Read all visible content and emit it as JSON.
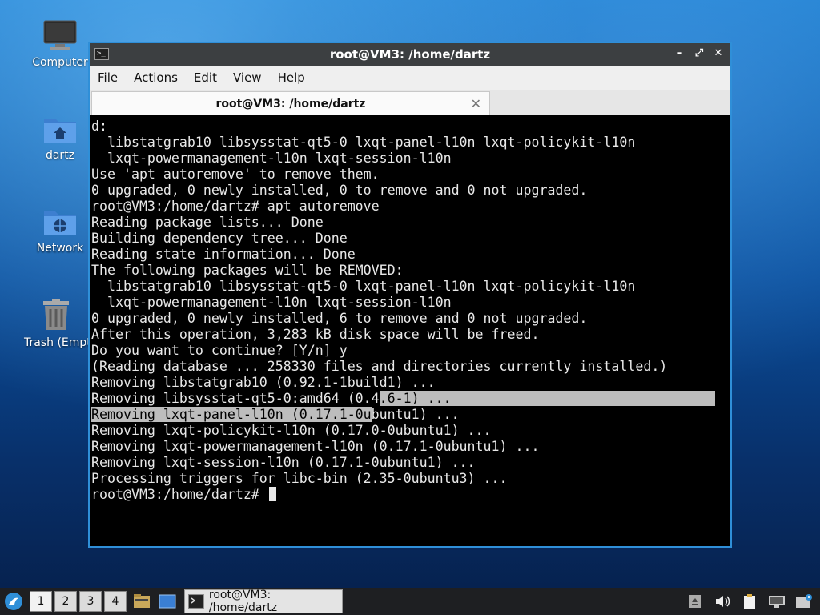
{
  "desktop": {
    "icons": [
      {
        "label": "Computer"
      },
      {
        "label": "dartz"
      },
      {
        "label": "Network"
      },
      {
        "label": "Trash (Empty)"
      }
    ]
  },
  "window": {
    "title": "root@VM3: /home/dartz",
    "menu": [
      "File",
      "Actions",
      "Edit",
      "View",
      "Help"
    ],
    "tab_label": "root@VM3: /home/dartz",
    "prompt": "root@VM3:/home/dartz# "
  },
  "terminal": {
    "lines": [
      "d:",
      "  libstatgrab10 libsysstat-qt5-0 lxqt-panel-l10n lxqt-policykit-l10n",
      "  lxqt-powermanagement-l10n lxqt-session-l10n",
      "Use 'apt autoremove' to remove them.",
      "0 upgraded, 0 newly installed, 0 to remove and 0 not upgraded.",
      "root@VM3:/home/dartz# apt autoremove",
      "Reading package lists... Done",
      "Building dependency tree... Done",
      "Reading state information... Done",
      "The following packages will be REMOVED:",
      "  libstatgrab10 libsysstat-qt5-0 lxqt-panel-l10n lxqt-policykit-l10n",
      "  lxqt-powermanagement-l10n lxqt-session-l10n",
      "0 upgraded, 0 newly installed, 6 to remove and 0 not upgraded.",
      "After this operation, 3,283 kB disk space will be freed.",
      "Do you want to continue? [Y/n] y",
      "(Reading database ... 258330 files and directories currently installed.)",
      "Removing libstatgrab10 (0.92.1-1build1) ..."
    ],
    "sel_line1_pre": "Removing libsysstat-qt5-0:amd64 (0.4",
    "sel_line1_sel": ".6-1) ...                                 ",
    "sel_line2_sel": "Removing lxqt-panel-l10n (0.17.1-0u",
    "sel_line2_post": "buntu1) ...",
    "lines_after": [
      "Removing lxqt-policykit-l10n (0.17.0-0ubuntu1) ...",
      "Removing lxqt-powermanagement-l10n (0.17.1-0ubuntu1) ...",
      "Removing lxqt-session-l10n (0.17.1-0ubuntu1) ...",
      "Processing triggers for libc-bin (2.35-0ubuntu3) ..."
    ]
  },
  "taskbar": {
    "workspaces": [
      "1",
      "2",
      "3",
      "4"
    ],
    "task_label": "root@VM3: /home/dartz",
    "tray_icons": [
      "eject-icon",
      "volume-icon",
      "clipboard-icon",
      "network-icon",
      "notification-icon"
    ]
  },
  "colors": {
    "window_border": "#2f8fd8",
    "titlebar": "#3c3f41",
    "terminal_bg": "#000000",
    "terminal_fg": "#e8e8e8",
    "selection": "#bdbdbd"
  }
}
